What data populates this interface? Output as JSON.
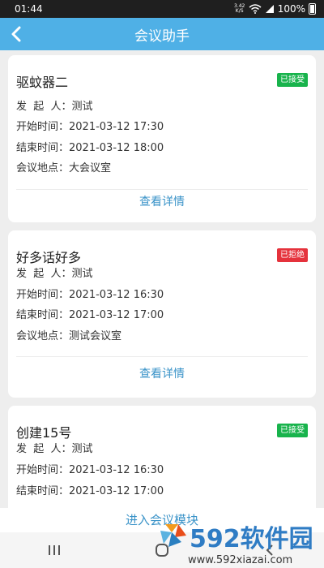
{
  "status": {
    "time": "01:44",
    "net_speed_value": "3.42",
    "net_speed_unit": "K/S",
    "battery": "100%"
  },
  "header": {
    "title": "会议助手"
  },
  "labels": {
    "initiator": "发  起  人：",
    "start": "开始时间：",
    "end": "结束时间：",
    "location": "会议地点：",
    "detail": "查看详情"
  },
  "meetings": [
    {
      "title": "驱蚊器二",
      "status": "已接受",
      "initiator": "测试",
      "start": "2021-03-12 17:30",
      "end": "2021-03-12 18:00",
      "location": "大会议室"
    },
    {
      "title": "好多话好多",
      "status": "已拒绝",
      "initiator": "测试",
      "start": "2021-03-12 16:30",
      "end": "2021-03-12 17:00",
      "location": "测试会议室"
    },
    {
      "title": "创建15号",
      "status": "已接受",
      "initiator": "测试",
      "start": "2021-03-12 16:30",
      "end": "2021-03-12 17:00",
      "location": ""
    }
  ],
  "footer": {
    "enter_module": "进入会议模块"
  },
  "watermark": {
    "brand": "592软件园",
    "url": "www.592xiazai.com"
  },
  "colors": {
    "header": "#4fb0e6",
    "accepted": "#18b34c",
    "rejected": "#e5323c",
    "link": "#3a93c8"
  }
}
